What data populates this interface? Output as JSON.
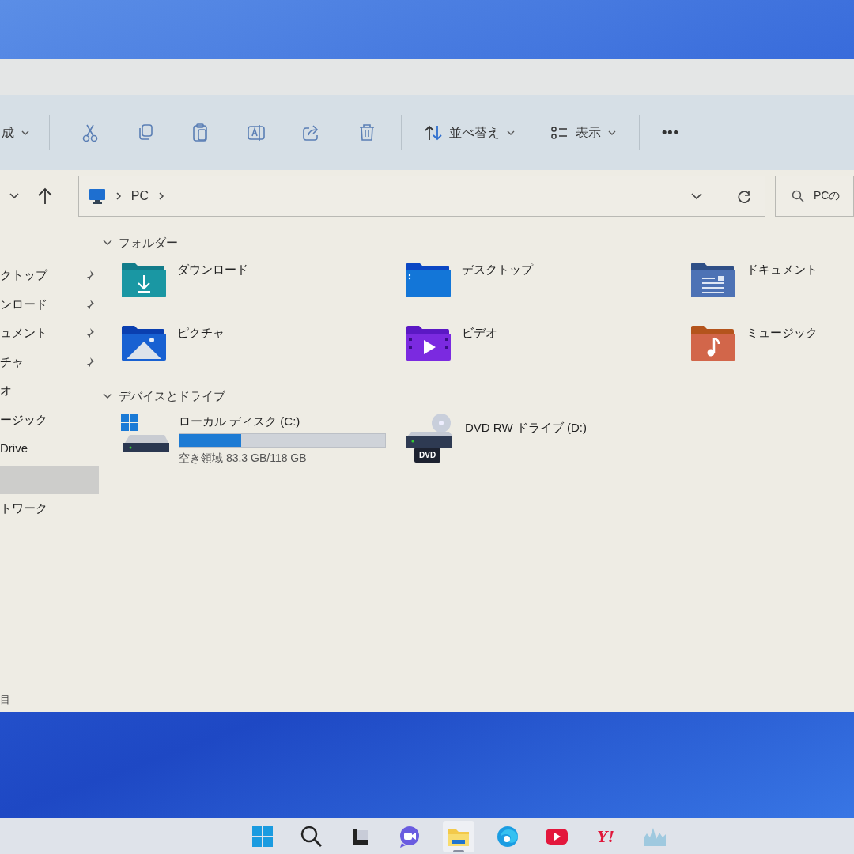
{
  "toolbar": {
    "new_label": "成",
    "sort_label": "並べ替え",
    "view_label": "表示",
    "more_label": "•••"
  },
  "address": {
    "crumbs": [
      "PC"
    ]
  },
  "search": {
    "placeholder": "PCの"
  },
  "sidebar": {
    "items": [
      {
        "label": "クトップ",
        "pinned": true,
        "selected": false
      },
      {
        "label": "ンロード",
        "pinned": true,
        "selected": false
      },
      {
        "label": "ュメント",
        "pinned": true,
        "selected": false
      },
      {
        "label": "チャ",
        "pinned": true,
        "selected": false
      },
      {
        "label": "オ",
        "pinned": false,
        "selected": false
      },
      {
        "label": "ージック",
        "pinned": false,
        "selected": false
      },
      {
        "label": "Drive",
        "pinned": false,
        "selected": false
      },
      {
        "pinned": false,
        "selected": true
      },
      {
        "label": "トワーク",
        "pinned": false,
        "selected": false
      }
    ]
  },
  "sections": [
    {
      "title": "フォルダー",
      "expanded": true,
      "kind": "folders",
      "items": [
        {
          "name": "ダウンロード",
          "kind": "downloads"
        },
        {
          "name": "デスクトップ",
          "kind": "desktop"
        },
        {
          "name": "ドキュメント",
          "kind": "documents"
        },
        {
          "name": "ピクチャ",
          "kind": "pictures"
        },
        {
          "name": "ビデオ",
          "kind": "videos"
        },
        {
          "name": "ミュージック",
          "kind": "music"
        }
      ]
    },
    {
      "title": "デバイスとドライブ",
      "expanded": true,
      "kind": "drives",
      "items": [
        {
          "name": "ローカル ディスク (C:)",
          "kind": "disk",
          "level": 0.3,
          "free": "空き領域 83.3 GB/118 GB"
        },
        {
          "name": "DVD RW ドライブ (D:)",
          "kind": "dvd",
          "badge": "DVD"
        }
      ]
    }
  ],
  "status_bar": {
    "text": "目"
  },
  "taskbar": [
    {
      "kind": "start",
      "selected": false
    },
    {
      "kind": "search",
      "selected": false
    },
    {
      "kind": "taskview",
      "selected": false
    },
    {
      "kind": "chat",
      "selected": false
    },
    {
      "kind": "explorer",
      "selected": true
    },
    {
      "kind": "edge",
      "selected": false
    },
    {
      "kind": "youtube",
      "selected": false
    },
    {
      "kind": "yahoo",
      "label": "Y!",
      "selected": false
    },
    {
      "kind": "monitor",
      "selected": false
    }
  ]
}
